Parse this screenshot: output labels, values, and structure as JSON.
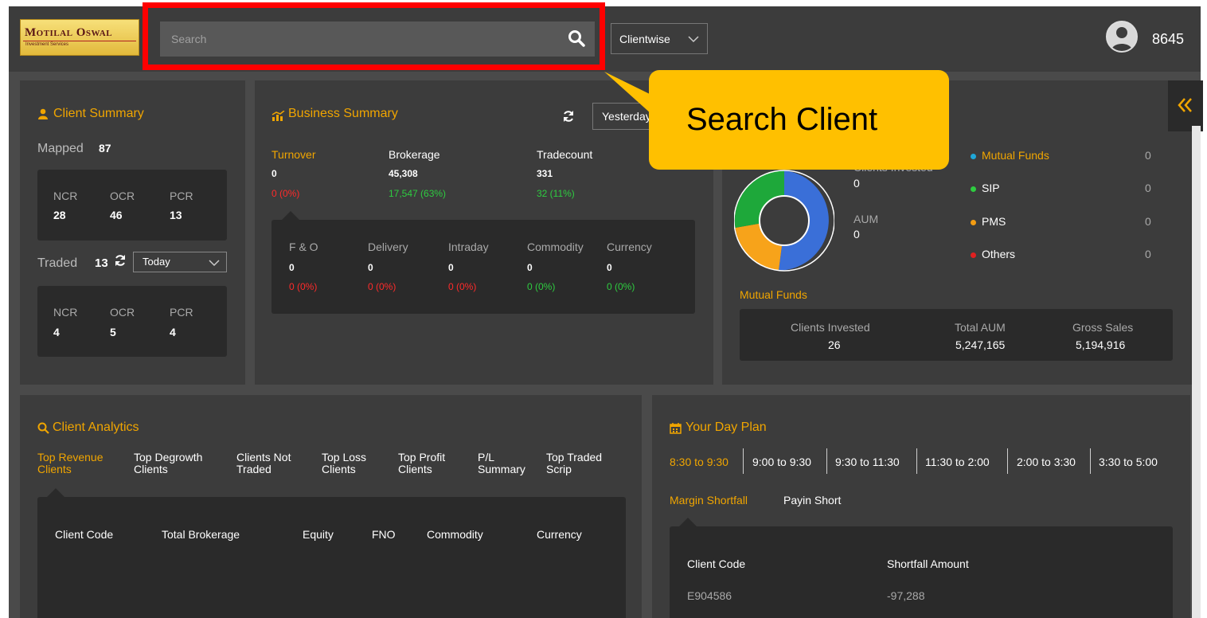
{
  "header": {
    "logo_text": "Motilal Oswal",
    "logo_subtext": "Investment Services",
    "search_placeholder": "Search",
    "view_select": "Clientwise",
    "user_code": "8645"
  },
  "callout": {
    "text": "Search Client"
  },
  "client_summary": {
    "title": "Client Summary",
    "mapped_label": "Mapped",
    "mapped_value": "87",
    "mapped_stats": [
      {
        "label": "NCR",
        "value": "28"
      },
      {
        "label": "OCR",
        "value": "46"
      },
      {
        "label": "PCR",
        "value": "13"
      }
    ],
    "traded_label": "Traded",
    "traded_value": "13",
    "traded_period": "Today",
    "traded_stats": [
      {
        "label": "NCR",
        "value": "4"
      },
      {
        "label": "OCR",
        "value": "5"
      },
      {
        "label": "PCR",
        "value": "4"
      }
    ]
  },
  "business_summary": {
    "title": "Business Summary",
    "period": "Yesterday",
    "metrics": [
      {
        "label": "Turnover",
        "value": "0",
        "change": "0 (0%)"
      },
      {
        "label": "Brokerage",
        "value": "45,308",
        "change": "17,547 (63%)"
      },
      {
        "label": "Tradecount",
        "value": "331",
        "change": "32 (11%)"
      }
    ],
    "segments": [
      {
        "label": "F & O",
        "value": "0",
        "change": "0 (0%)"
      },
      {
        "label": "Delivery",
        "value": "0",
        "change": "0 (0%)"
      },
      {
        "label": "Intraday",
        "value": "0",
        "change": "0 (0%)"
      },
      {
        "label": "Commodity",
        "value": "0",
        "change": "0 (0%)"
      },
      {
        "label": "Currency",
        "value": "0",
        "change": "0 (0%)"
      }
    ]
  },
  "investments": {
    "clients_invested_label": "Clients Invested",
    "clients_invested_value": "0",
    "aum_label": "AUM",
    "aum_value": "0",
    "chart_caption": "Mutual Funds",
    "legend": [
      {
        "label": "Mutual Funds",
        "value": "0",
        "color": "#1fa7d8"
      },
      {
        "label": "SIP",
        "value": "0",
        "color": "#2ecc40"
      },
      {
        "label": "PMS",
        "value": "0",
        "color": "#f39c12"
      },
      {
        "label": "Others",
        "value": "0",
        "color": "#e02020"
      }
    ],
    "mf_stats": [
      {
        "label": "Clients Invested",
        "value": "26"
      },
      {
        "label": "Total AUM",
        "value": "5,247,165"
      },
      {
        "label": "Gross Sales",
        "value": "5,194,916"
      }
    ]
  },
  "client_analytics": {
    "title": "Client Analytics",
    "tabs": [
      {
        "line1": "Top Revenue",
        "line2": "Clients"
      },
      {
        "line1": "Top Degrowth",
        "line2": "Clients"
      },
      {
        "line1": "Clients Not",
        "line2": "Traded"
      },
      {
        "line1": "Top Loss",
        "line2": "Clients"
      },
      {
        "line1": "Top Profit",
        "line2": "Clients"
      },
      {
        "line1": "P/L",
        "line2": "Summary"
      },
      {
        "line1": "Top Traded",
        "line2": "Scrip"
      }
    ],
    "columns": [
      "Client Code",
      "Total Brokerage",
      "Equity",
      "FNO",
      "Commodity",
      "Currency"
    ]
  },
  "day_plan": {
    "title": "Your Day Plan",
    "slots": [
      "8:30 to 9:30",
      "9:00 to 9:30",
      "9:30 to 11:30",
      "11:30 to 2:00",
      "2:00 to 3:30",
      "3:30 to 5:00"
    ],
    "subtabs": [
      "Margin Shortfall",
      "Payin Short"
    ],
    "columns": [
      "Client Code",
      "Shortfall Amount"
    ],
    "rows": [
      {
        "client_code": "E904586",
        "amount": "-97,288"
      }
    ]
  },
  "colors": {
    "accent": "#f0a500",
    "panel": "#3c3c3c",
    "dark_box": "#2a2a2a",
    "highlight": "#ff0000",
    "callout": "#ffc000"
  }
}
